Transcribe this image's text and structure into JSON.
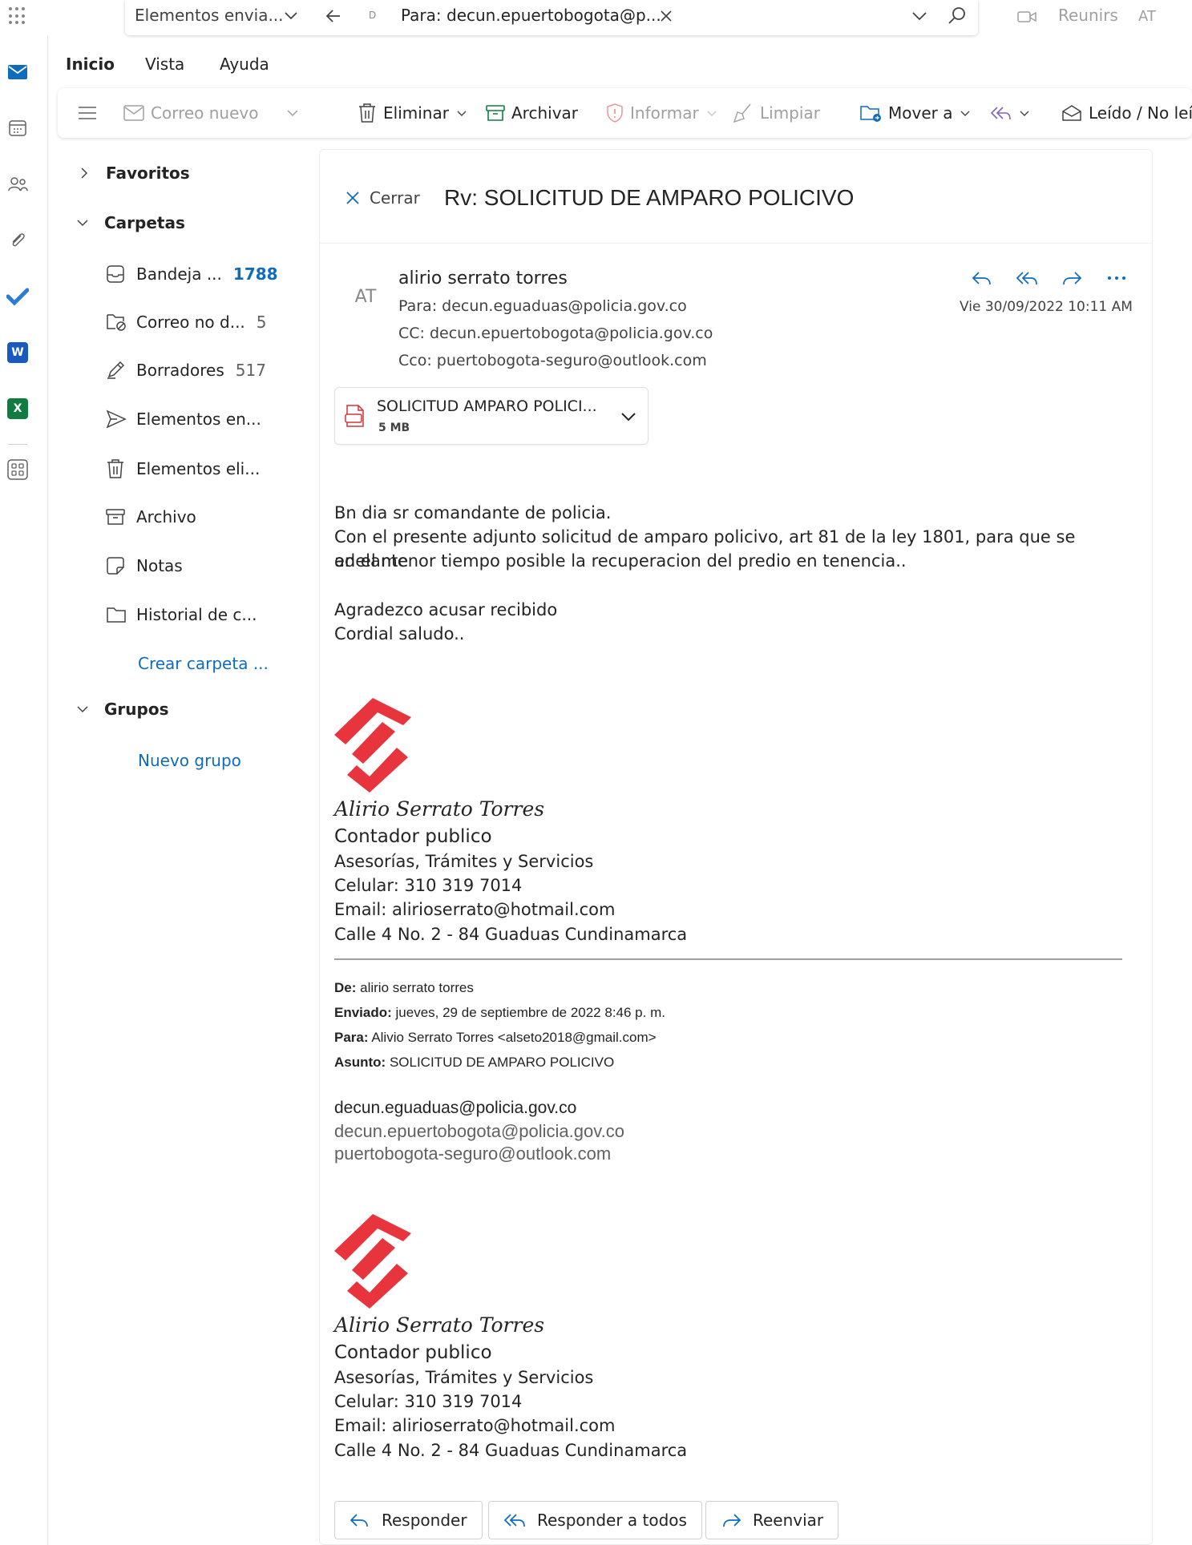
{
  "search": {
    "scope": "Elementos envia...",
    "chip": "D",
    "query": "Para: decun.epuertobogota@p...",
    "meet_label": "Reunirse",
    "account_initials": "AT"
  },
  "tabs": [
    "Inicio",
    "Vista",
    "Ayuda"
  ],
  "toolbar": {
    "new_mail": "Correo nuevo",
    "delete": "Eliminar",
    "archive": "Archivar",
    "report": "Informar",
    "sweep": "Limpiar",
    "move": "Mover a",
    "read_unread": "Leído / No leído"
  },
  "folders": {
    "favorites": "Favoritos",
    "folders": "Carpetas",
    "items": [
      {
        "label": "Bandeja ...",
        "count": "1788"
      },
      {
        "label": "Correo no d...",
        "count": "5"
      },
      {
        "label": "Borradores",
        "count": "517"
      },
      {
        "label": "Elementos en...",
        "count": ""
      },
      {
        "label": "Elementos eli...",
        "count": ""
      },
      {
        "label": "Archivo",
        "count": ""
      },
      {
        "label": "Notas",
        "count": ""
      },
      {
        "label": "Historial de c...",
        "count": ""
      }
    ],
    "create_folder": "Crear carpeta ...",
    "groups": "Grupos",
    "new_group": "Nuevo grupo"
  },
  "message": {
    "close": "Cerrar",
    "subject": "Rv: SOLICITUD DE AMPARO POLICIVO",
    "avatar_initials": "AT",
    "sender": "alirio serrato torres",
    "to": "Para:  decun.eguaduas@policia.gov.co",
    "cc": "CC:  decun.epuertobogota@policia.gov.co",
    "bcc": "Cco:  puertobogota-seguro@outlook.com",
    "date": "Vie 30/09/2022 10:11 AM",
    "attachment": {
      "name": "SOLICITUD AMPARO POLICI...",
      "size": "5 MB"
    },
    "body": [
      "Bn dia sr comandante de policia.",
      "Con el presente adjunto solicitud de amparo policivo, art 81 de la ley 1801, para que se adelante",
      "en el menor tiempo posible la recuperacion del predio en tenencia..",
      "Agradezco acusar recibido",
      "Cordial saludo.."
    ],
    "signature": {
      "name": "Alirio Serrato Torres",
      "title": "Contador publico",
      "services": "Asesorías, Trámites y Servicios",
      "phone": "Celular: 310 319 7014",
      "email": "Email: alirioserrato@hotmail.com",
      "address": "Calle 4 No. 2 - 84 Guaduas Cundinamarca"
    },
    "forwarded": {
      "from_label": "De:",
      "from": " alirio serrato torres",
      "sent_label": "Enviado:",
      "sent": " jueves, 29 de septiembre de 2022 8:46 p. m.",
      "to_label": "Para:",
      "to": " Alivio Serrato Torres <alseto2018@gmail.com>",
      "subject_label": "Asunto:",
      "subject": " SOLICITUD DE AMPARO POLICIVO",
      "addresses": [
        "decun.eguaduas@policia.gov.co",
        "decun.epuertobogota@policia.gov.co",
        "puertobogota-seguro@outlook.com"
      ]
    }
  },
  "reply_buttons": {
    "reply": "Responder",
    "reply_all": "Responder a todos",
    "forward": "Reenviar"
  },
  "colors": {
    "accent": "#0f6cbd",
    "logo_red": "#e8343c",
    "reply_all_purple": "#8764b8"
  }
}
